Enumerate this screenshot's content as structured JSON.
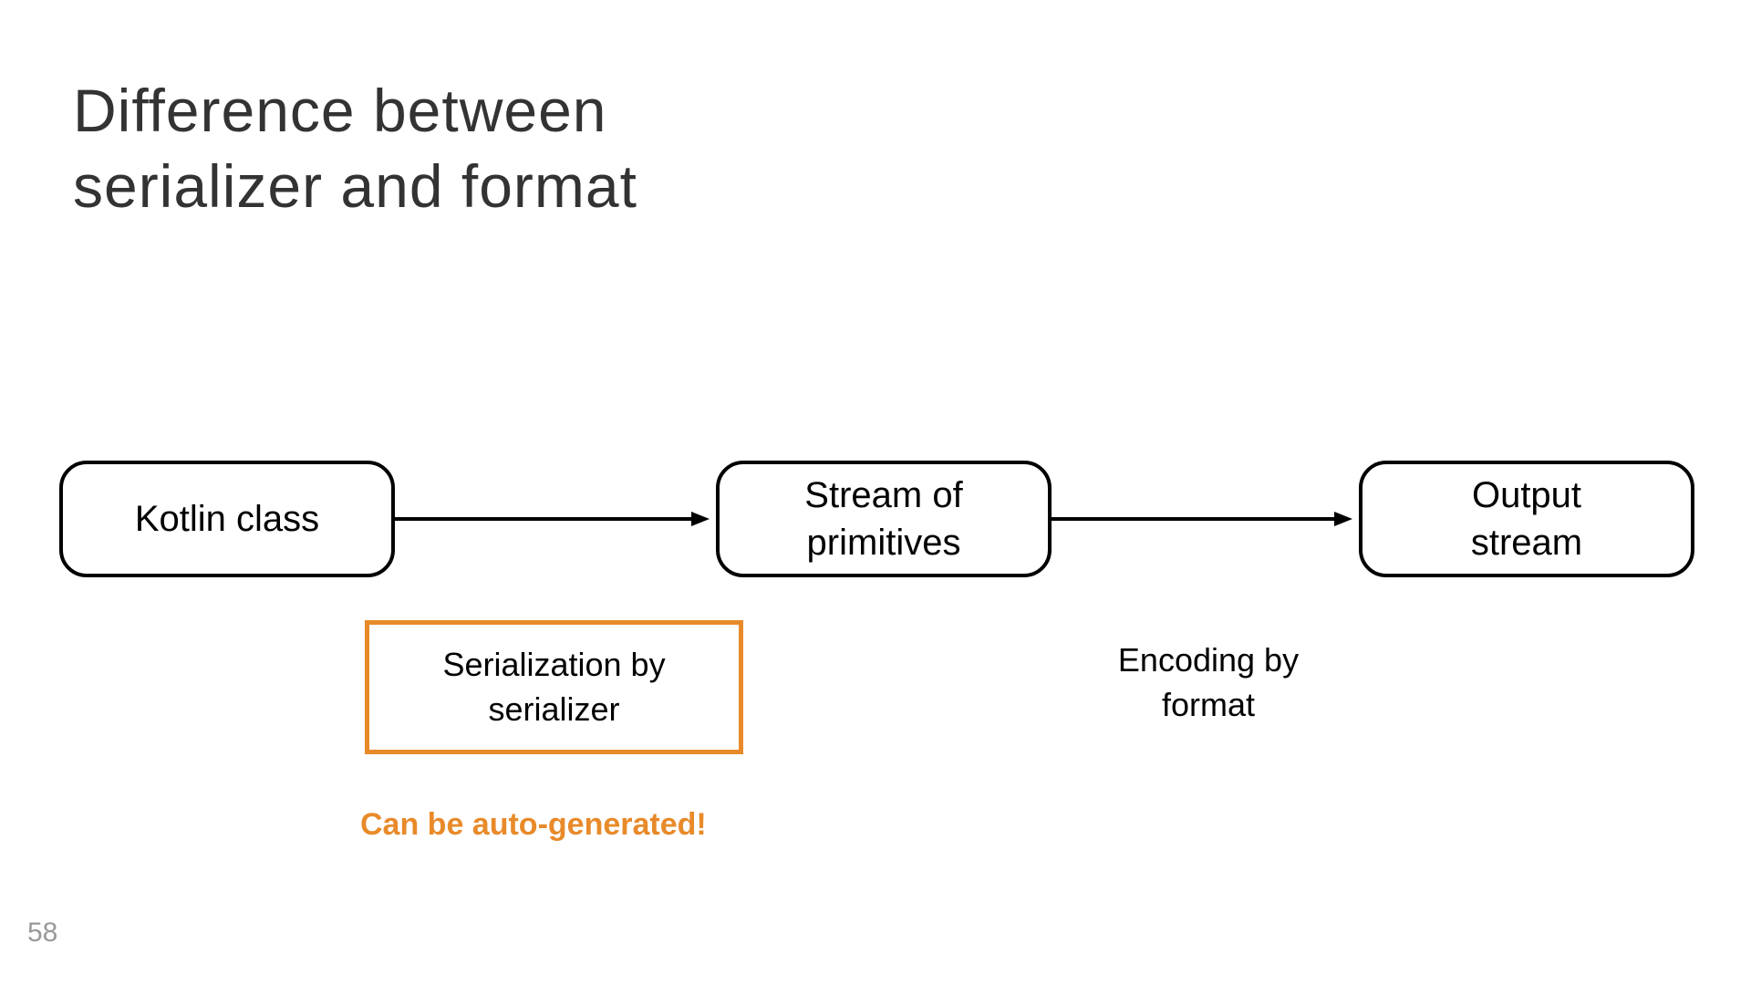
{
  "slide": {
    "title": "Difference between\nserializer and format",
    "page_number": "58"
  },
  "diagram": {
    "nodes": [
      {
        "label": "Kotlin class"
      },
      {
        "label": "Stream of\nprimitives"
      },
      {
        "label": "Output\nstream"
      }
    ],
    "edge_labels": [
      {
        "text": "Serialization by\nserializer",
        "highlighted": true
      },
      {
        "text": "Encoding by\nformat",
        "highlighted": false
      }
    ],
    "callout": "Can be auto-generated!"
  },
  "colors": {
    "accent": "#e88a2a",
    "text": "#333333",
    "muted": "#999999"
  }
}
